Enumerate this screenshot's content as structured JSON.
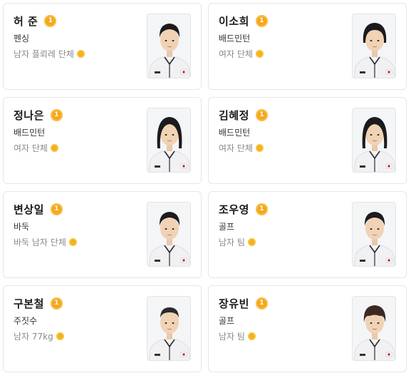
{
  "athletes": [
    {
      "name": "허 준",
      "medal": "1",
      "sport": "펜싱",
      "event": "남자 플뢰레 단체"
    },
    {
      "name": "이소희",
      "medal": "1",
      "sport": "배드민턴",
      "event": "여자 단체"
    },
    {
      "name": "정나은",
      "medal": "1",
      "sport": "배드민턴",
      "event": "여자 단체"
    },
    {
      "name": "김혜정",
      "medal": "1",
      "sport": "배드민턴",
      "event": "여자 단체"
    },
    {
      "name": "변상일",
      "medal": "1",
      "sport": "바둑",
      "event": "바둑 남자 단체"
    },
    {
      "name": "조우영",
      "medal": "1",
      "sport": "골프",
      "event": "남자 팀"
    },
    {
      "name": "구본철",
      "medal": "1",
      "sport": "주짓수",
      "event": "남자 77kg"
    },
    {
      "name": "장유빈",
      "medal": "1",
      "sport": "골프",
      "event": "남자 팀"
    }
  ],
  "colors": {
    "medal_gold": "#f5a71c",
    "jacket": "#f1f1f3",
    "hair": "#1b1b1d"
  },
  "icons": {
    "medal": "gold-medal-icon",
    "gold_dot": "gold-dot-icon"
  }
}
